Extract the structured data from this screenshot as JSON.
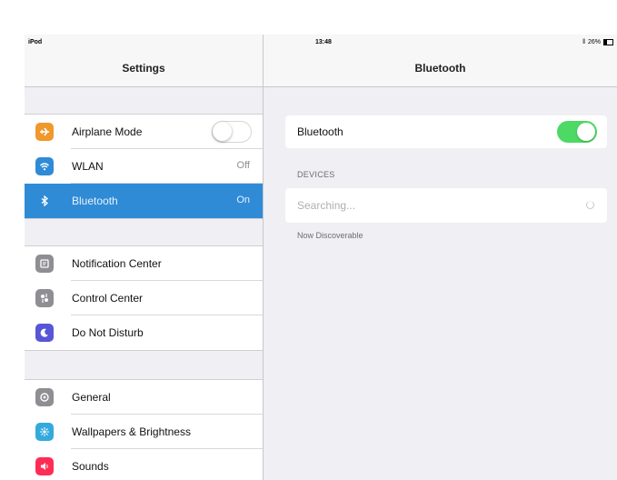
{
  "status": {
    "device": "iPod",
    "time": "13:48",
    "battery": "26%"
  },
  "master": {
    "title": "Settings",
    "group1": [
      {
        "label": "Airplane Mode",
        "value": "",
        "icon": "airplane-icon",
        "color": "#f0982a"
      },
      {
        "label": "WLAN",
        "value": "Off",
        "icon": "wifi-icon",
        "color": "#2f8bd6"
      },
      {
        "label": "Bluetooth",
        "value": "On",
        "icon": "bluetooth-icon",
        "color": "#2f8bd6"
      }
    ],
    "group2": [
      {
        "label": "Notification Center",
        "icon": "notification-center-icon",
        "color": "#8e8e93"
      },
      {
        "label": "Control Center",
        "icon": "control-center-icon",
        "color": "#8e8e93"
      },
      {
        "label": "Do Not Disturb",
        "icon": "do-not-disturb-icon",
        "color": "#5856d6"
      }
    ],
    "group3": [
      {
        "label": "General",
        "icon": "gear-icon",
        "color": "#8e8e93"
      },
      {
        "label": "Wallpapers & Brightness",
        "icon": "wallpaper-icon",
        "color": "#34aadc"
      },
      {
        "label": "Sounds",
        "icon": "sounds-icon",
        "color": "#ff2d55"
      }
    ]
  },
  "detail": {
    "title": "Bluetooth",
    "bluetooth_label": "Bluetooth",
    "bluetooth_on": true,
    "devices_header": "DEVICES",
    "searching_label": "Searching...",
    "discoverable_note": "Now Discoverable"
  },
  "colors": {
    "accent": "#2f8bd6",
    "toggle_on": "#4cd964"
  }
}
